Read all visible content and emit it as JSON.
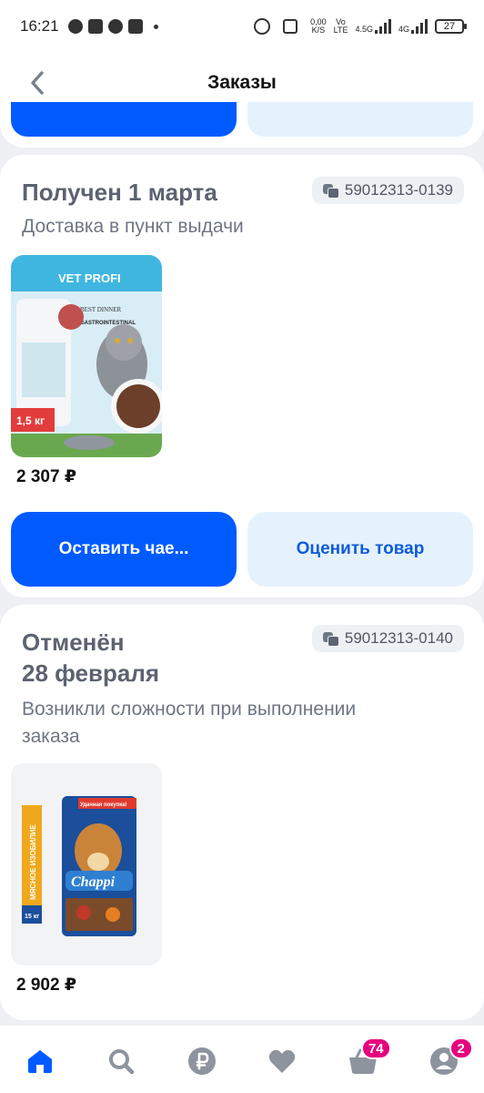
{
  "status_bar": {
    "time": "16:21",
    "net_speed": "0,00",
    "net_unit": "K/S",
    "volte_top": "Vo",
    "volte_bottom": "LTE",
    "sig1": "4.5G",
    "sig2": "4G",
    "battery": "27"
  },
  "header": {
    "title": "Заказы",
    "back_icon": "chevron-left-icon"
  },
  "orders": [
    {
      "status": "Получен 1 марта",
      "order_number": "59012313-0139",
      "delivery": "Доставка в пункт выдачи",
      "price": "2 307 ₽",
      "product_image": {
        "brand_banner": "VET PROFI",
        "product_line": "BEST DINNER",
        "variant": "GASTROINTESTINAL",
        "weight": "1,5 кг"
      },
      "buttons": {
        "primary": "Оставить чае...",
        "secondary": "Оценить товар"
      }
    },
    {
      "status_line1": "Отменён",
      "status_line2": "28 февраля",
      "order_number": "59012313-0140",
      "reason_line1": "Возникли сложности при выполнении",
      "reason_line2": "заказа",
      "price": "2 902 ₽",
      "product_image": {
        "side_label": "МЯСНОЕ ИЗОБИЛИЕ",
        "weight": "15 кг",
        "tag": "Удачная покупка!",
        "brand": "Chappi"
      }
    }
  ],
  "tabbar": {
    "items": [
      {
        "icon": "home-icon",
        "active": true
      },
      {
        "icon": "search-icon",
        "active": false
      },
      {
        "icon": "ruble-icon",
        "active": false
      },
      {
        "icon": "heart-icon",
        "active": false
      },
      {
        "icon": "cart-icon",
        "active": false,
        "badge": "74"
      },
      {
        "icon": "profile-icon",
        "active": false,
        "badge": "2"
      }
    ]
  },
  "colors": {
    "accent": "#005bff",
    "secondary_button_bg": "#e5f2fd",
    "badge": "#e6007e"
  }
}
